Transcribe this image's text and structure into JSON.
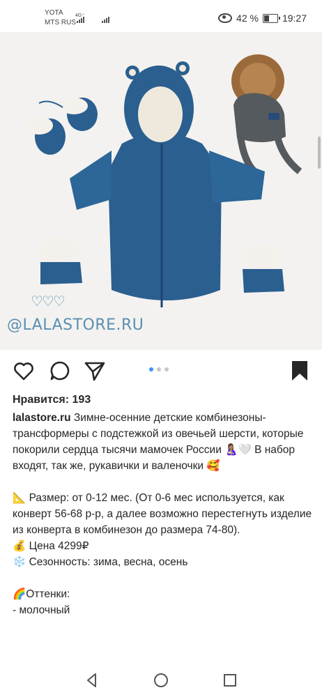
{
  "status_bar": {
    "carrier_1": "YOTA",
    "carrier_2": "MTS RUS",
    "network": "4G⁺",
    "battery": "42 %",
    "battery_level": 0.42,
    "time": "19:27"
  },
  "post": {
    "watermark": "@LALASTORE.RU",
    "hearts": "♡♡♡",
    "carousel": {
      "count": 3,
      "active": 1
    },
    "likes": "Нравится: 193",
    "username": "lalastore.ru",
    "caption": " Зимне-осенние детские комбинезоны-трансформеры с подстежкой из овечьей шерсти, которые покорили сердца тысячи мамочек России 🤱🏽🤍 В набор входят, так же, рукавички и валеночки 🥰\n\n📐 Размер: от 0-12 мес. (От 0-6 мес используется, как конверт 56-68 р-р, а далее возможно перестегнуть изделие из конверта в комбинезон до размера 74-80).\n💰 Цена 4299₽\n❄️ Сезонность: зима, весна, осень\n\n🌈Оттенки:\n- молочный"
  },
  "colors": {
    "accent": "#3897f0",
    "suit": "#2a5f8f",
    "watermark": "#5a8fb0"
  },
  "icons": {
    "like": "heart-icon",
    "comment": "comment-icon",
    "share": "share-icon",
    "save": "bookmark-icon",
    "back": "back-icon",
    "home": "home-icon",
    "recents": "recents-icon"
  }
}
